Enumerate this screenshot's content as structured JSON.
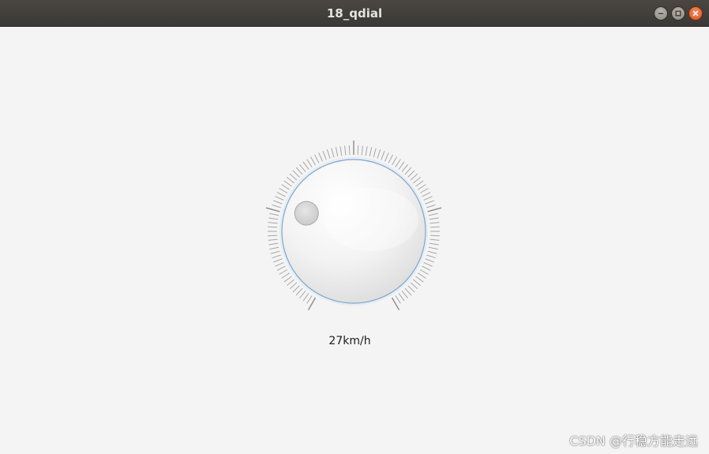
{
  "window": {
    "title": "18_qdial",
    "controls": {
      "minimize_icon": "minimize-icon",
      "maximize_icon": "maximize-icon",
      "close_icon": "close-icon"
    }
  },
  "dial": {
    "value": 27,
    "minimum": 0,
    "maximum": 100,
    "notches_visible": true,
    "label": "27km/h",
    "accent_color": "#5b9bd5"
  },
  "watermark": {
    "text": "CSDN @行稳方能走远"
  }
}
